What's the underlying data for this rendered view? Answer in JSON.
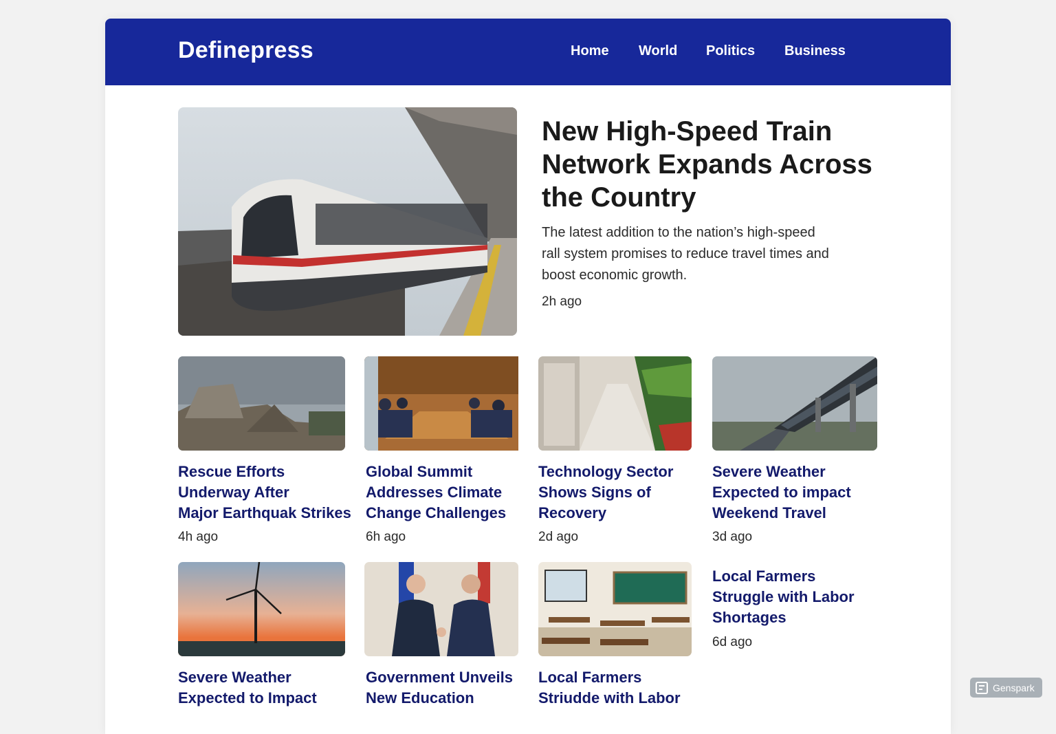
{
  "site": {
    "brand": "Definepress"
  },
  "nav": {
    "items": [
      {
        "label": "Home"
      },
      {
        "label": "World"
      },
      {
        "label": "Politics"
      },
      {
        "label": "Business"
      }
    ]
  },
  "hero": {
    "title_lines": [
      "New High-Speed Train",
      "Network Expands Across",
      "the Country"
    ],
    "desc_lines": [
      "The latest addition to the nation’s high-speed",
      "rall system promises to reduce travel times and",
      "boost economic growth."
    ],
    "time": "2h ago",
    "image": "high-speed-train-photo"
  },
  "articles": [
    {
      "title_lines": [
        "Rescue Efforts",
        "Underway After",
        "Major Earthquak Strikes"
      ],
      "time": "4h ago",
      "image": "earthquake-rubble-photo"
    },
    {
      "title_lines": [
        "Global Summit",
        "Addresses Climate",
        "Change Challenges"
      ],
      "time": "6h ago",
      "image": "summit-meeting-photo"
    },
    {
      "title_lines": [
        "Technology Sector",
        "Shows Signs of",
        "Recovery"
      ],
      "time": "2d ago",
      "image": "grocery-aisle-photo"
    },
    {
      "title_lines": [
        "Severe Weather",
        "Expected to impact",
        "Weekend Travel"
      ],
      "time": "3d ago",
      "image": "elevated-railway-photo"
    },
    {
      "title_lines": [
        "Severe Weather",
        "Expected to Impact"
      ],
      "time": "",
      "image": "wind-turbine-sunset-photo"
    },
    {
      "title_lines": [
        "Government Unveils",
        "New Education"
      ],
      "time": "",
      "image": "leaders-handshake-photo"
    },
    {
      "title_lines": [
        "Local Farmers",
        "Striudde with Labor"
      ],
      "time": "",
      "image": "classroom-photo"
    },
    {
      "title_lines": [
        "Local Farmers",
        "Struggle with Labor",
        "Shortages"
      ],
      "time": "6d ago",
      "image": ""
    }
  ],
  "watermark": {
    "label": "Genspark",
    "icon": "genspark-logo-icon"
  }
}
